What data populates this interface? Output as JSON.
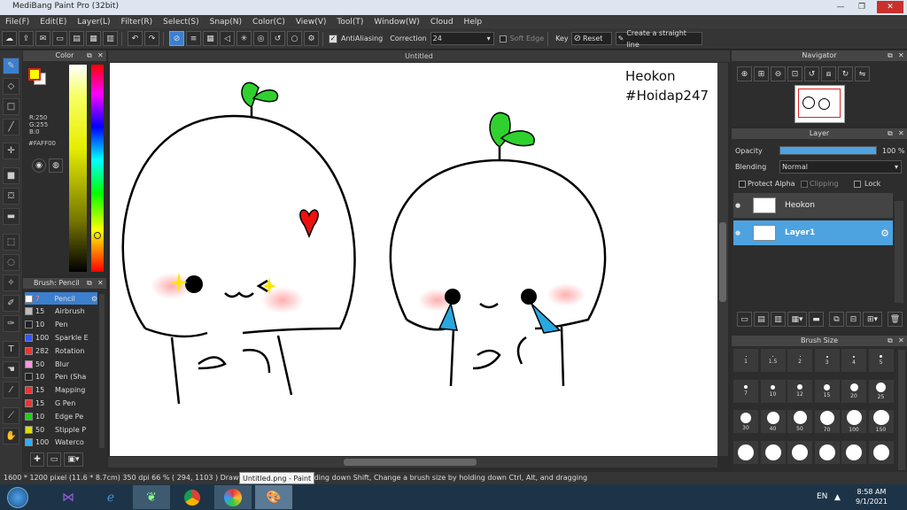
{
  "window": {
    "title": "MediBang Paint Pro (32bit)"
  },
  "menu": [
    "File(F)",
    "Edit(E)",
    "Layer(L)",
    "Filter(R)",
    "Select(S)",
    "Snap(N)",
    "Color(C)",
    "View(V)",
    "Tool(T)",
    "Window(W)",
    "Cloud",
    "Help"
  ],
  "toolbar": {
    "antialias_label": "AntiAliasing",
    "correction_label": "Correction",
    "correction_value": "24",
    "soft_edge_label": "Soft Edge",
    "key_label": "Key",
    "reset_label": "Reset",
    "straight_line_label": "Create a straight line"
  },
  "color_panel": {
    "title": "Color",
    "r": "R:250",
    "g": "G:255",
    "b": "B:0",
    "hex": "#FAFF00",
    "fg_color": "#FAFF00",
    "bg_color": "#FFFFFF"
  },
  "brush_panel": {
    "title": "Brush: Pencil",
    "items": [
      {
        "size": "7",
        "name": "Pencil",
        "color": "#ffffff",
        "selected": true
      },
      {
        "size": "15",
        "name": "Airbrush",
        "color": "#bbbbbb"
      },
      {
        "size": "10",
        "name": "Pen",
        "color": "#222222"
      },
      {
        "size": "100",
        "name": "Sparkle E",
        "color": "#3355ff"
      },
      {
        "size": "282",
        "name": "Rotation",
        "color": "#ee3333"
      },
      {
        "size": "50",
        "name": "Blur",
        "color": "#ff99dd"
      },
      {
        "size": "10",
        "name": "Pen (Sha",
        "color": "#222222"
      },
      {
        "size": "15",
        "name": "Mapping",
        "color": "#ee3333"
      },
      {
        "size": "15",
        "name": "G Pen",
        "color": "#ee3333"
      },
      {
        "size": "10",
        "name": "Edge Pe",
        "color": "#22cc22"
      },
      {
        "size": "50",
        "name": "Stipple P",
        "color": "#dddd00"
      },
      {
        "size": "100",
        "name": "Waterco",
        "color": "#33aaff"
      }
    ]
  },
  "canvas": {
    "tab_title": "Untitled",
    "text_line1": "Heokon",
    "text_line2": "#Hoidap247"
  },
  "navigator": {
    "title": "Navigator"
  },
  "layer_panel": {
    "title": "Layer",
    "opacity_label": "Opacity",
    "opacity_value": "100 %",
    "opacity_fraction": 1.0,
    "blending_label": "Blending",
    "blending_value": "Normal",
    "protect_alpha_label": "Protect Alpha",
    "clipping_label": "Clipping",
    "lock_label": "Lock",
    "layers": [
      {
        "name": "Heokon",
        "selected": false
      },
      {
        "name": "Layer1",
        "selected": true
      }
    ]
  },
  "brush_size": {
    "title": "Brush Size",
    "sizes": [
      "1",
      "1.5",
      "2",
      "3",
      "4",
      "5",
      "7",
      "10",
      "12",
      "15",
      "20",
      "25",
      "30",
      "40",
      "50",
      "70",
      "100",
      "150",
      "",
      "",
      "",
      "",
      "",
      ""
    ],
    "dots": [
      1,
      1,
      1,
      2,
      2,
      3,
      4,
      5,
      6,
      7,
      9,
      11,
      12,
      14,
      15,
      16,
      17,
      18,
      18,
      18,
      18,
      18,
      18,
      18
    ]
  },
  "status": {
    "info": "1600 * 1200 pixel   (11.6 * 8.7cm)   350 dpi   66 %   ( 294, 1103 )   Draw a straight line by holding down Shift, Change a brush size by holding down Ctrl, Alt, and dragging",
    "tooltip": "Untitled.png - Paint"
  },
  "taskbar": {
    "lang": "EN",
    "time": "8:58 AM",
    "date": "9/1/2021"
  }
}
